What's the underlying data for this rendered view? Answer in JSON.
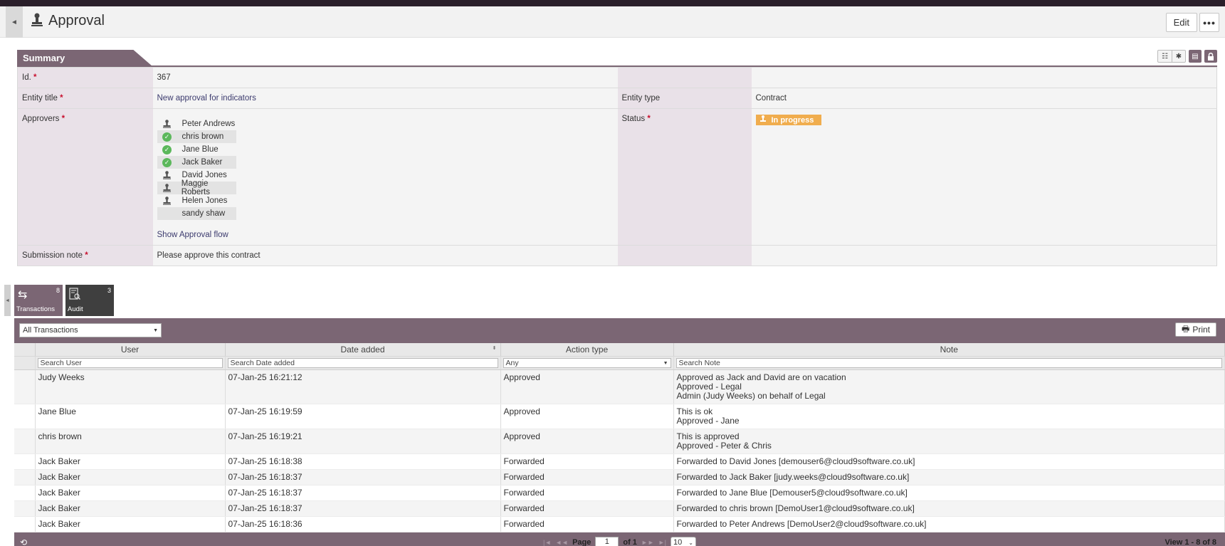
{
  "header": {
    "title": "Approval",
    "edit_label": "Edit",
    "more_label": "•••"
  },
  "summary": {
    "section_title": "Summary",
    "fields": {
      "id_label": "Id.",
      "id_value": "367",
      "entity_title_label": "Entity title",
      "entity_title_value": "New approval for indicators",
      "entity_type_label": "Entity type",
      "entity_type_value": "Contract",
      "approvers_label": "Approvers",
      "status_label": "Status",
      "status_value": "In progress",
      "show_flow_label": "Show Approval flow",
      "submission_note_label": "Submission note",
      "submission_note_value": "Please approve this contract"
    },
    "required_mark": "*",
    "approvers": [
      {
        "name": "Peter Andrews",
        "icon": "user-icon",
        "shaded": false
      },
      {
        "name": "chris brown",
        "icon": "check-icon",
        "shaded": true
      },
      {
        "name": "Jane Blue",
        "icon": "check-icon",
        "shaded": false
      },
      {
        "name": "Jack Baker",
        "icon": "check-icon",
        "shaded": true
      },
      {
        "name": "David Jones",
        "icon": "user-icon",
        "shaded": false
      },
      {
        "name": "Maggie Roberts",
        "icon": "user-icon",
        "shaded": true
      },
      {
        "name": "Helen Jones",
        "icon": "user-icon",
        "shaded": false
      },
      {
        "name": "sandy shaw",
        "icon": "",
        "shaded": true
      }
    ]
  },
  "tabs": [
    {
      "label": "Transactions",
      "count": "8"
    },
    {
      "label": "Audit",
      "count": "3"
    }
  ],
  "grid": {
    "filter_value": "All Transactions",
    "print_label": "Print",
    "columns": [
      "User",
      "Date added",
      "Action type",
      "Note"
    ],
    "filters": {
      "user_placeholder": "Search User",
      "date_placeholder": "Search Date added",
      "action_value": "Any",
      "note_placeholder": "Search Note"
    },
    "rows": [
      {
        "user": "Judy Weeks",
        "date": "07-Jan-25 16:21:12",
        "action": "Approved",
        "note": [
          "Approved as Jack and David are on vacation",
          "Approved - Legal",
          "Admin (Judy Weeks) on behalf of Legal"
        ]
      },
      {
        "user": "Jane Blue",
        "date": "07-Jan-25 16:19:59",
        "action": "Approved",
        "note": [
          "This is ok",
          "Approved - Jane"
        ]
      },
      {
        "user": "chris brown",
        "date": "07-Jan-25 16:19:21",
        "action": "Approved",
        "note": [
          "This is approved",
          "Approved - Peter & Chris"
        ]
      },
      {
        "user": "Jack Baker",
        "date": "07-Jan-25 16:18:38",
        "action": "Forwarded",
        "note": [
          "Forwarded to David Jones [demouser6@cloud9software.co.uk]"
        ]
      },
      {
        "user": "Jack Baker",
        "date": "07-Jan-25 16:18:37",
        "action": "Forwarded",
        "note": [
          "Forwarded to Jack Baker [judy.weeks@cloud9software.co.uk]"
        ]
      },
      {
        "user": "Jack Baker",
        "date": "07-Jan-25 16:18:37",
        "action": "Forwarded",
        "note": [
          "Forwarded to Jane Blue [Demouser5@cloud9software.co.uk]"
        ]
      },
      {
        "user": "Jack Baker",
        "date": "07-Jan-25 16:18:37",
        "action": "Forwarded",
        "note": [
          "Forwarded to chris brown [DemoUser1@cloud9software.co.uk]"
        ]
      },
      {
        "user": "Jack Baker",
        "date": "07-Jan-25 16:18:36",
        "action": "Forwarded",
        "note": [
          "Forwarded to Peter Andrews [DemoUser2@cloud9software.co.uk]"
        ]
      }
    ],
    "pager": {
      "page_label": "Page",
      "page_value": "1",
      "of_label": "of 1",
      "page_size": "10",
      "view_count": "View 1 - 8 of 8"
    }
  },
  "colors": {
    "accent": "#7b6674",
    "label_bg": "#e9e1e8",
    "status_orange": "#f0ad4e",
    "check_green": "#5cb85c"
  }
}
